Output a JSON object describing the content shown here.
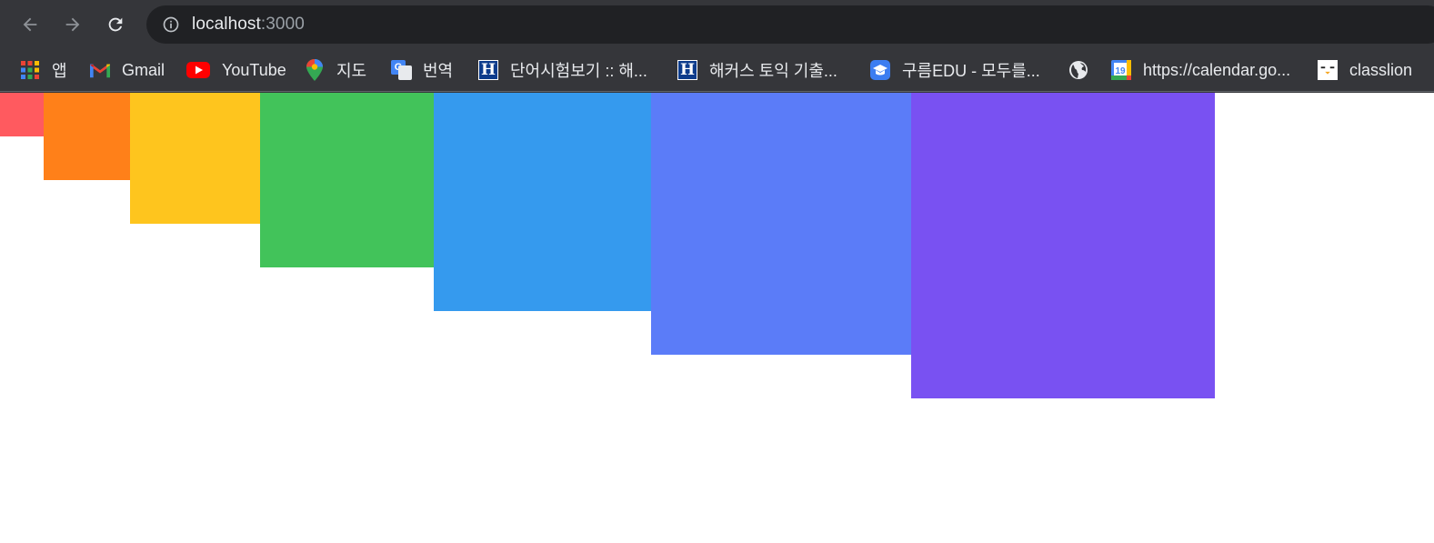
{
  "browser": {
    "url_host": "localhost",
    "url_port": ":3000",
    "bookmarks": [
      {
        "label": "앱",
        "icon": "apps-grid-icon"
      },
      {
        "label": "Gmail",
        "icon": "gmail-icon"
      },
      {
        "label": "YouTube",
        "icon": "youtube-icon"
      },
      {
        "label": "지도",
        "icon": "maps-pin-icon"
      },
      {
        "label": "번역",
        "icon": "translate-icon"
      },
      {
        "label": "단어시험보기 :: 해...",
        "icon": "hackers-h-icon"
      },
      {
        "label": "해커스 토익 기출...",
        "icon": "hackers-h-icon"
      },
      {
        "label": "구름EDU - 모두를...",
        "icon": "goorm-edu-icon"
      },
      {
        "label": "",
        "icon": "globe-icon"
      },
      {
        "label": "https://calendar.go...",
        "icon": "calendar-icon"
      },
      {
        "label": "classlion",
        "icon": "classlion-icon"
      }
    ],
    "calendar_icon_day": "19",
    "hackers_icon_letter": "H",
    "translate_icon_letter": "G"
  },
  "page": {
    "boxes": [
      {
        "color": "#ff5a5f"
      },
      {
        "color": "#ff8019"
      },
      {
        "color": "#fec51e"
      },
      {
        "color": "#42c35a"
      },
      {
        "color": "#359aee"
      },
      {
        "color": "#5b7cf8"
      },
      {
        "color": "#7951f2"
      }
    ]
  }
}
